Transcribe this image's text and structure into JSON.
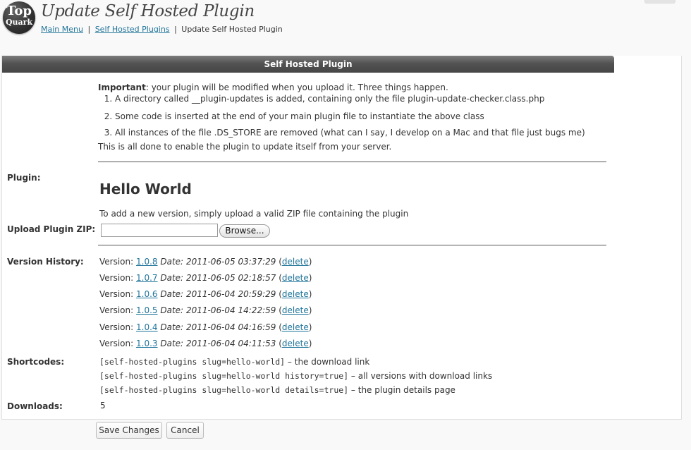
{
  "header": {
    "logo_line1": "Top",
    "logo_line2": "Quark",
    "title": "Update Self Hosted Plugin",
    "breadcrumb": {
      "item1": "Main Menu",
      "item2": "Self Hosted Plugins",
      "current": "Update Self Hosted Plugin",
      "separator": "|"
    }
  },
  "panel": {
    "title": "Self Hosted Plugin",
    "intro": {
      "important_label": "Important",
      "important_text": ": your plugin will be modified when you upload it. Three things happen.",
      "steps": [
        "A directory called __plugin-updates is added, containing only the file plugin-update-checker.class.php",
        "Some code is inserted at the end of your main plugin file to instantiate the above class",
        "All instances of the file .DS_STORE are removed (what can I say, I develop on a Mac and that file just bugs me)"
      ],
      "outro": "This is all done to enable the plugin to update itself from your server."
    },
    "plugin_label": "Plugin:",
    "plugin_name": "Hello World",
    "upload_help": "To add a new version, simply upload a valid ZIP file containing the plugin",
    "upload_label": "Upload Plugin ZIP:",
    "browse_label": "Browse...",
    "history_label": "Version History:",
    "version_prefix": "Version:",
    "date_prefix": "Date:",
    "delete_label": "delete",
    "versions": [
      {
        "version": "1.0.8",
        "date": "2011-06-05 03:37:29"
      },
      {
        "version": "1.0.7",
        "date": "2011-06-05 02:18:57"
      },
      {
        "version": "1.0.6",
        "date": "2011-06-04 20:59:29"
      },
      {
        "version": "1.0.5",
        "date": "2011-06-04 14:22:59"
      },
      {
        "version": "1.0.4",
        "date": "2011-06-04 04:16:59"
      },
      {
        "version": "1.0.3",
        "date": "2011-06-04 04:11:53"
      }
    ],
    "shortcodes_label": "Shortcodes:",
    "shortcodes": [
      {
        "code": "[self-hosted-plugins slug=hello-world]",
        "desc": " – the download link"
      },
      {
        "code": "[self-hosted-plugins slug=hello-world history=true]",
        "desc": " – all versions with download links"
      },
      {
        "code": "[self-hosted-plugins slug=hello-world details=true]",
        "desc": " – the plugin details page"
      }
    ],
    "downloads_label": "Downloads:",
    "downloads_value": "5"
  },
  "actions": {
    "save_label": "Save Changes",
    "cancel_label": "Cancel"
  }
}
